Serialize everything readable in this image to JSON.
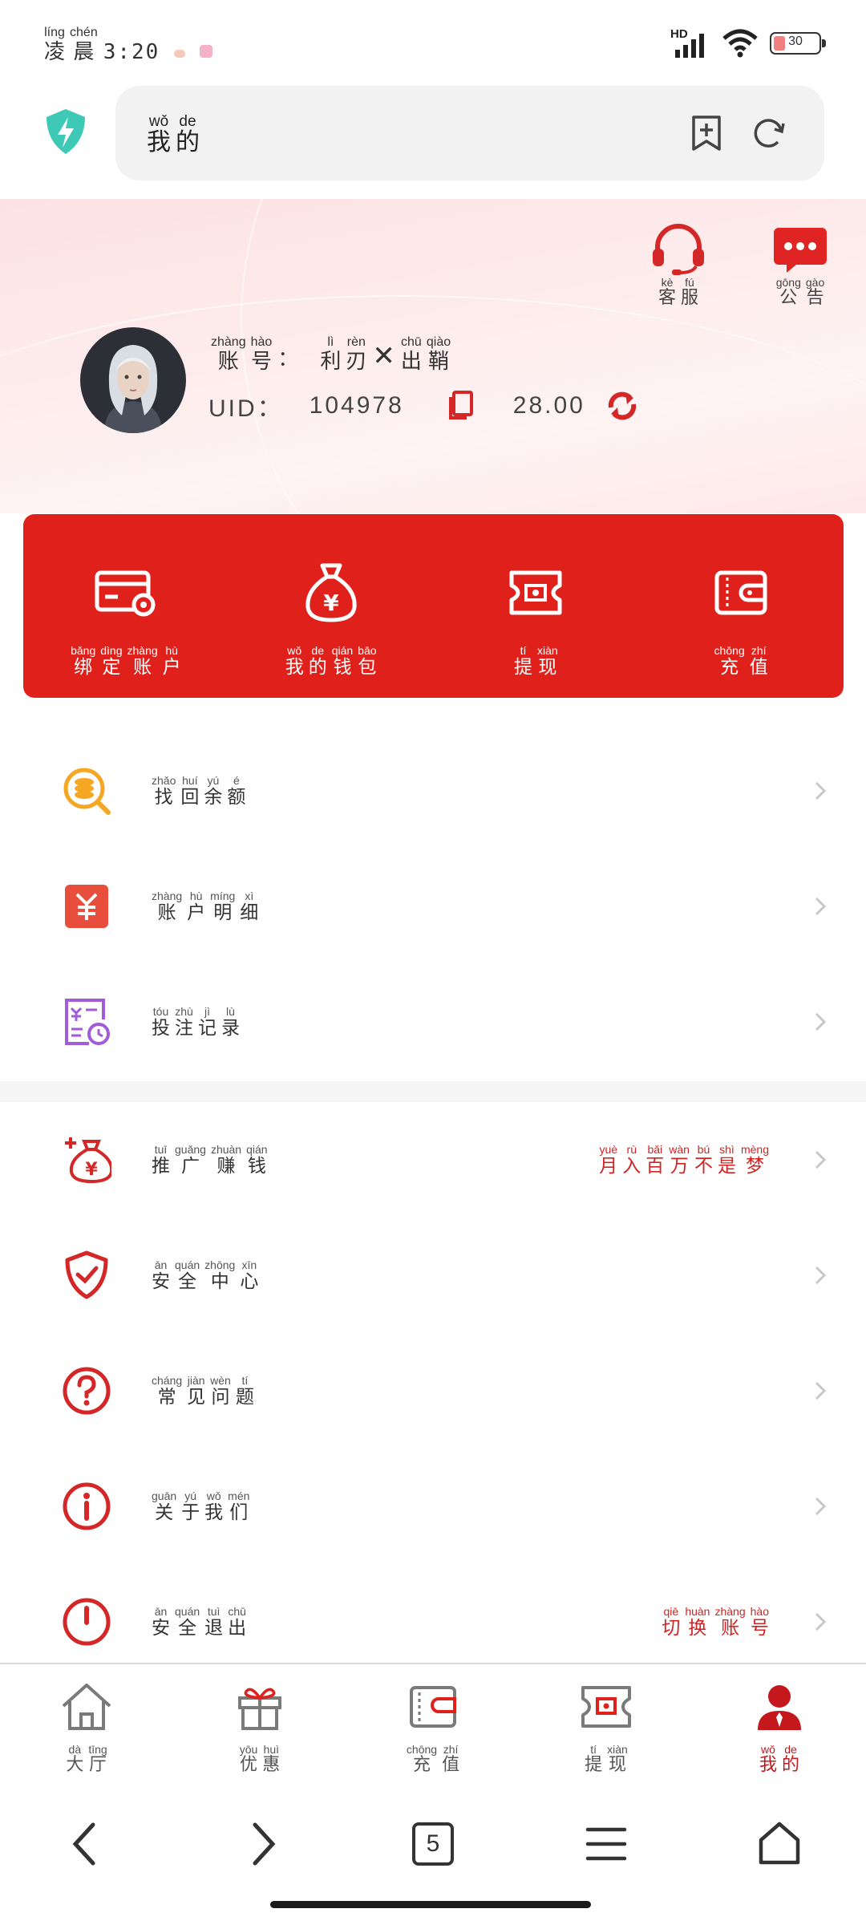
{
  "status_bar": {
    "time_chars": [
      {
        "hz": "凌",
        "py": "líng"
      },
      {
        "hz": "晨",
        "py": "chén"
      }
    ],
    "clock": "3:20",
    "network": "HD",
    "battery": "30"
  },
  "browser": {
    "title_chars": [
      {
        "hz": "我",
        "py": "wǒ"
      },
      {
        "hz": "的",
        "py": "de"
      }
    ]
  },
  "header": {
    "customer_service": [
      {
        "hz": "客",
        "py": "kè"
      },
      {
        "hz": "服",
        "py": "fú"
      }
    ],
    "announcement": [
      {
        "hz": "公",
        "py": "gōng"
      },
      {
        "hz": "告",
        "py": "gào"
      }
    ],
    "account_label": [
      {
        "hz": "账",
        "py": "zhàng"
      },
      {
        "hz": "号",
        "py": "hào"
      }
    ],
    "account_sep": "：",
    "account_name_a": [
      {
        "hz": "利",
        "py": "lì"
      },
      {
        "hz": "刃",
        "py": "rèn"
      }
    ],
    "account_x": "✕",
    "account_name_b": [
      {
        "hz": "出",
        "py": "chū"
      },
      {
        "hz": "鞘",
        "py": "qiào"
      }
    ],
    "uid_label": "UID：",
    "uid_value": "104978",
    "balance": "28.00"
  },
  "actions": [
    {
      "name": "bind-account",
      "icon": "card-gear-icon",
      "chars": [
        {
          "hz": "绑",
          "py": "bǎng"
        },
        {
          "hz": "定",
          "py": "dìng"
        },
        {
          "hz": "账",
          "py": "zhàng"
        },
        {
          "hz": "户",
          "py": "hù"
        }
      ]
    },
    {
      "name": "my-wallet",
      "icon": "money-bag-icon",
      "chars": [
        {
          "hz": "我",
          "py": "wǒ"
        },
        {
          "hz": "的",
          "py": "de"
        },
        {
          "hz": "钱",
          "py": "qián"
        },
        {
          "hz": "包",
          "py": "bāo"
        }
      ]
    },
    {
      "name": "withdraw",
      "icon": "ticket-cash-icon",
      "chars": [
        {
          "hz": "提",
          "py": "tí"
        },
        {
          "hz": "现",
          "py": "xiàn"
        }
      ]
    },
    {
      "name": "recharge",
      "icon": "wallet-icon",
      "chars": [
        {
          "hz": "充",
          "py": "chōng"
        },
        {
          "hz": "值",
          "py": "zhí"
        }
      ]
    }
  ],
  "menu_group1": [
    {
      "name": "recover-balance",
      "icon": "coin-search-icon",
      "color": "#f5a623",
      "chars": [
        {
          "hz": "找",
          "py": "zhǎo"
        },
        {
          "hz": "回",
          "py": "huí"
        },
        {
          "hz": "余",
          "py": "yú"
        },
        {
          "hz": "额",
          "py": "é"
        }
      ]
    },
    {
      "name": "account-details",
      "icon": "yuan-ledger-icon",
      "color": "#e84e3c",
      "chars": [
        {
          "hz": "账",
          "py": "zhàng"
        },
        {
          "hz": "户",
          "py": "hù"
        },
        {
          "hz": "明",
          "py": "míng"
        },
        {
          "hz": "细",
          "py": "xì"
        }
      ]
    },
    {
      "name": "bet-records",
      "icon": "record-clock-icon",
      "color": "#a25bd9",
      "chars": [
        {
          "hz": "投",
          "py": "tóu"
        },
        {
          "hz": "注",
          "py": "zhù"
        },
        {
          "hz": "记",
          "py": "jì"
        },
        {
          "hz": "录",
          "py": "lù"
        }
      ]
    }
  ],
  "menu_group2": [
    {
      "name": "promote-earn",
      "icon": "money-bag-plus-icon",
      "chars": [
        {
          "hz": "推",
          "py": "tuī"
        },
        {
          "hz": "广",
          "py": "guǎng"
        },
        {
          "hz": "赚",
          "py": "zhuàn"
        },
        {
          "hz": "钱",
          "py": "qián"
        }
      ],
      "right": [
        {
          "hz": "月",
          "py": "yuè"
        },
        {
          "hz": "入",
          "py": "rù"
        },
        {
          "hz": "百",
          "py": "bǎi"
        },
        {
          "hz": "万",
          "py": "wàn"
        },
        {
          "hz": "不",
          "py": "bú"
        },
        {
          "hz": "是",
          "py": "shì"
        },
        {
          "hz": "梦",
          "py": "mèng"
        }
      ]
    },
    {
      "name": "security-center",
      "icon": "shield-check-icon",
      "chars": [
        {
          "hz": "安",
          "py": "ān"
        },
        {
          "hz": "全",
          "py": "quán"
        },
        {
          "hz": "中",
          "py": "zhōng"
        },
        {
          "hz": "心",
          "py": "xīn"
        }
      ]
    },
    {
      "name": "faq",
      "icon": "question-circle-icon",
      "chars": [
        {
          "hz": "常",
          "py": "cháng"
        },
        {
          "hz": "见",
          "py": "jiàn"
        },
        {
          "hz": "问",
          "py": "wèn"
        },
        {
          "hz": "题",
          "py": "tí"
        }
      ]
    },
    {
      "name": "about-us",
      "icon": "info-circle-icon",
      "chars": [
        {
          "hz": "关",
          "py": "guān"
        },
        {
          "hz": "于",
          "py": "yú"
        },
        {
          "hz": "我",
          "py": "wǒ"
        },
        {
          "hz": "们",
          "py": "mén"
        }
      ]
    },
    {
      "name": "safe-logout",
      "icon": "power-icon",
      "chars": [
        {
          "hz": "安",
          "py": "ān"
        },
        {
          "hz": "全",
          "py": "quán"
        },
        {
          "hz": "退",
          "py": "tuì"
        },
        {
          "hz": "出",
          "py": "chū"
        }
      ],
      "right": [
        {
          "hz": "切",
          "py": "qiē"
        },
        {
          "hz": "换",
          "py": "huàn"
        },
        {
          "hz": "账",
          "py": "zhàng"
        },
        {
          "hz": "号",
          "py": "hào"
        }
      ]
    }
  ],
  "tabs": [
    {
      "name": "lobby",
      "icon": "house-icon",
      "active": false,
      "chars": [
        {
          "hz": "大",
          "py": "dà"
        },
        {
          "hz": "厅",
          "py": "tīng"
        }
      ]
    },
    {
      "name": "promotions",
      "icon": "gift-icon",
      "active": false,
      "chars": [
        {
          "hz": "优",
          "py": "yōu"
        },
        {
          "hz": "惠",
          "py": "huì"
        }
      ]
    },
    {
      "name": "recharge",
      "icon": "wallet-icon",
      "active": false,
      "chars": [
        {
          "hz": "充",
          "py": "chōng"
        },
        {
          "hz": "值",
          "py": "zhí"
        }
      ]
    },
    {
      "name": "withdraw",
      "icon": "ticket-cash-icon",
      "active": false,
      "chars": [
        {
          "hz": "提",
          "py": "tí"
        },
        {
          "hz": "现",
          "py": "xiàn"
        }
      ]
    },
    {
      "name": "mine",
      "icon": "user-icon",
      "active": true,
      "chars": [
        {
          "hz": "我",
          "py": "wǒ"
        },
        {
          "hz": "的",
          "py": "de"
        }
      ]
    }
  ],
  "sysnav": {
    "tab_count": "5"
  },
  "colors": {
    "accent": "#e0201b",
    "active_tab": "#c4181c",
    "shield": "#3ec8b6"
  }
}
